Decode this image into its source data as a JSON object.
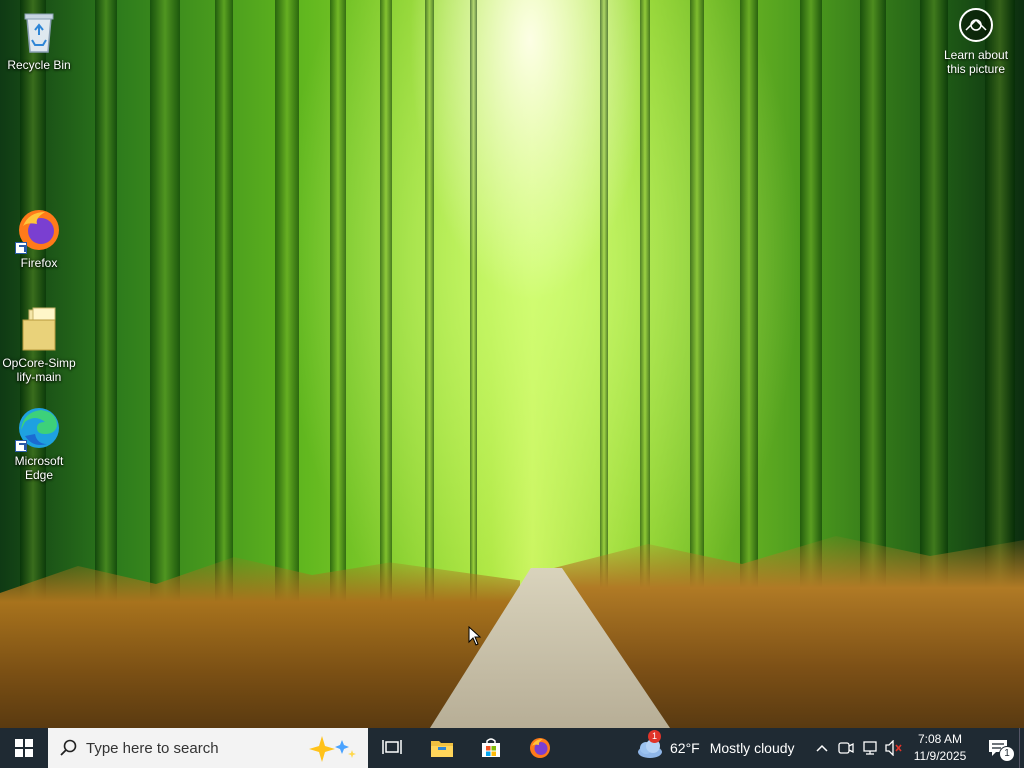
{
  "desktop": {
    "icons": [
      {
        "label": "Recycle Bin",
        "icon": "recycle-bin-icon"
      },
      {
        "label": "Firefox",
        "icon": "firefox-icon"
      },
      {
        "label": "OpCore-Simplify-main",
        "icon": "folder-icon"
      },
      {
        "label": "Microsoft Edge",
        "icon": "edge-icon"
      }
    ],
    "learn_picture": {
      "label": "Learn about this picture",
      "icon": "camera-icon"
    }
  },
  "taskbar": {
    "start_icon": "windows-logo-icon",
    "search": {
      "placeholder": "Type here to search",
      "icon": "search-icon"
    },
    "pinned": [
      {
        "name": "Task View",
        "icon": "task-view-icon"
      },
      {
        "name": "File Explorer",
        "icon": "file-explorer-icon"
      },
      {
        "name": "Microsoft Store",
        "icon": "store-icon"
      },
      {
        "name": "Firefox",
        "icon": "firefox-icon"
      }
    ],
    "weather": {
      "temp": "62°F",
      "condition": "Mostly cloudy",
      "badge": "1"
    },
    "clock": {
      "time": "7:08 AM",
      "date": "11/9/2025"
    },
    "notifications": {
      "count": "1"
    },
    "colors": {
      "taskbar_bg": "#1f2a33",
      "search_bg": "#f3f3f3"
    }
  }
}
